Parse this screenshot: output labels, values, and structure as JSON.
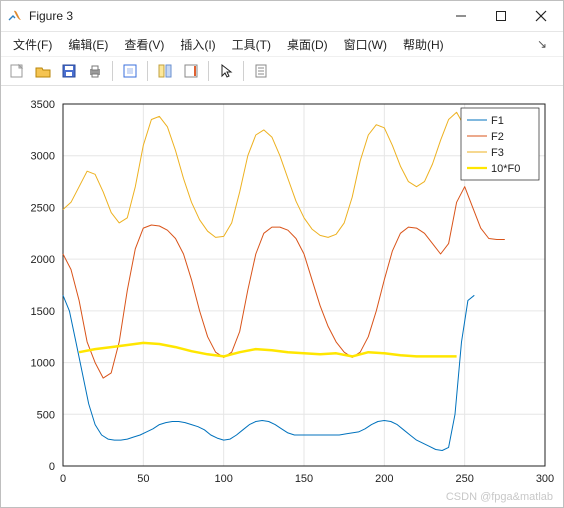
{
  "window": {
    "title": "Figure 3"
  },
  "menu": {
    "file": "文件(F)",
    "edit": "编辑(E)",
    "view": "查看(V)",
    "insert": "插入(I)",
    "tools": "工具(T)",
    "desktop": "桌面(D)",
    "window": "窗口(W)",
    "help": "帮助(H)"
  },
  "watermark": "CSDN @fpga&matlab",
  "chart_data": {
    "type": "line",
    "xlabel": "",
    "ylabel": "",
    "xlim": [
      0,
      300
    ],
    "ylim": [
      0,
      3500
    ],
    "xticks": [
      0,
      50,
      100,
      150,
      200,
      250,
      300
    ],
    "yticks": [
      0,
      500,
      1000,
      1500,
      2000,
      2500,
      3000,
      3500
    ],
    "legend_position": "northeast",
    "series": [
      {
        "name": "F1",
        "color": "#0072bd",
        "width": 1,
        "x": [
          0,
          4,
          8,
          12,
          16,
          20,
          24,
          28,
          32,
          36,
          40,
          44,
          48,
          52,
          56,
          60,
          64,
          68,
          72,
          76,
          80,
          84,
          88,
          92,
          96,
          100,
          104,
          108,
          112,
          116,
          120,
          124,
          128,
          132,
          136,
          140,
          144,
          148,
          152,
          156,
          160,
          164,
          168,
          172,
          176,
          180,
          184,
          188,
          192,
          196,
          200,
          204,
          208,
          212,
          216,
          220,
          224,
          228,
          232,
          236,
          240,
          244,
          248,
          252,
          256
        ],
        "y": [
          1650,
          1500,
          1200,
          900,
          600,
          400,
          300,
          260,
          250,
          250,
          260,
          280,
          300,
          330,
          360,
          400,
          420,
          430,
          430,
          420,
          400,
          380,
          350,
          300,
          270,
          250,
          260,
          300,
          350,
          400,
          430,
          440,
          430,
          400,
          360,
          320,
          300,
          300,
          300,
          300,
          300,
          300,
          300,
          300,
          310,
          320,
          330,
          360,
          400,
          430,
          440,
          430,
          400,
          350,
          300,
          250,
          220,
          190,
          160,
          150,
          180,
          500,
          1200,
          1600,
          1650
        ]
      },
      {
        "name": "F2",
        "color": "#d95319",
        "width": 1,
        "x": [
          0,
          5,
          10,
          15,
          20,
          25,
          30,
          35,
          40,
          45,
          50,
          55,
          60,
          65,
          70,
          75,
          80,
          85,
          90,
          95,
          100,
          105,
          110,
          115,
          120,
          125,
          130,
          135,
          140,
          145,
          150,
          155,
          160,
          165,
          170,
          175,
          180,
          185,
          190,
          195,
          200,
          205,
          210,
          215,
          220,
          225,
          230,
          235,
          240,
          245,
          250,
          255,
          260,
          265,
          270,
          275
        ],
        "y": [
          2050,
          1900,
          1600,
          1200,
          1000,
          850,
          900,
          1200,
          1700,
          2100,
          2300,
          2330,
          2320,
          2280,
          2200,
          2050,
          1800,
          1500,
          1250,
          1100,
          1050,
          1100,
          1300,
          1700,
          2050,
          2250,
          2310,
          2310,
          2280,
          2200,
          2050,
          1800,
          1550,
          1350,
          1200,
          1100,
          1050,
          1100,
          1250,
          1500,
          1800,
          2080,
          2250,
          2310,
          2300,
          2250,
          2150,
          2050,
          2150,
          2550,
          2700,
          2500,
          2300,
          2200,
          2190,
          2190
        ]
      },
      {
        "name": "F3",
        "color": "#edb120",
        "width": 1,
        "x": [
          0,
          5,
          10,
          15,
          20,
          25,
          30,
          35,
          40,
          45,
          50,
          55,
          60,
          65,
          70,
          75,
          80,
          85,
          90,
          95,
          100,
          105,
          110,
          115,
          120,
          125,
          130,
          135,
          140,
          145,
          150,
          155,
          160,
          165,
          170,
          175,
          180,
          185,
          190,
          195,
          200,
          205,
          210,
          215,
          220,
          225,
          230,
          235,
          240,
          245,
          250,
          255,
          260
        ],
        "y": [
          2480,
          2550,
          2700,
          2850,
          2820,
          2650,
          2450,
          2350,
          2400,
          2700,
          3100,
          3350,
          3380,
          3280,
          3050,
          2780,
          2550,
          2380,
          2270,
          2210,
          2220,
          2350,
          2650,
          3000,
          3200,
          3250,
          3180,
          3000,
          2780,
          2560,
          2400,
          2290,
          2230,
          2210,
          2240,
          2350,
          2600,
          2950,
          3200,
          3300,
          3270,
          3100,
          2900,
          2750,
          2700,
          2750,
          2920,
          3150,
          3350,
          3420,
          3280,
          3050,
          2780
        ]
      },
      {
        "name": "10*F0",
        "color": "#ffe600",
        "width": 2.5,
        "x": [
          10,
          20,
          30,
          40,
          50,
          60,
          70,
          80,
          90,
          100,
          110,
          120,
          130,
          140,
          150,
          160,
          170,
          180,
          190,
          200,
          210,
          220,
          230,
          240,
          245
        ],
        "y": [
          1100,
          1130,
          1150,
          1170,
          1190,
          1180,
          1150,
          1110,
          1080,
          1060,
          1100,
          1130,
          1120,
          1100,
          1090,
          1080,
          1090,
          1060,
          1100,
          1090,
          1070,
          1060,
          1060,
          1060,
          1060
        ]
      }
    ]
  }
}
